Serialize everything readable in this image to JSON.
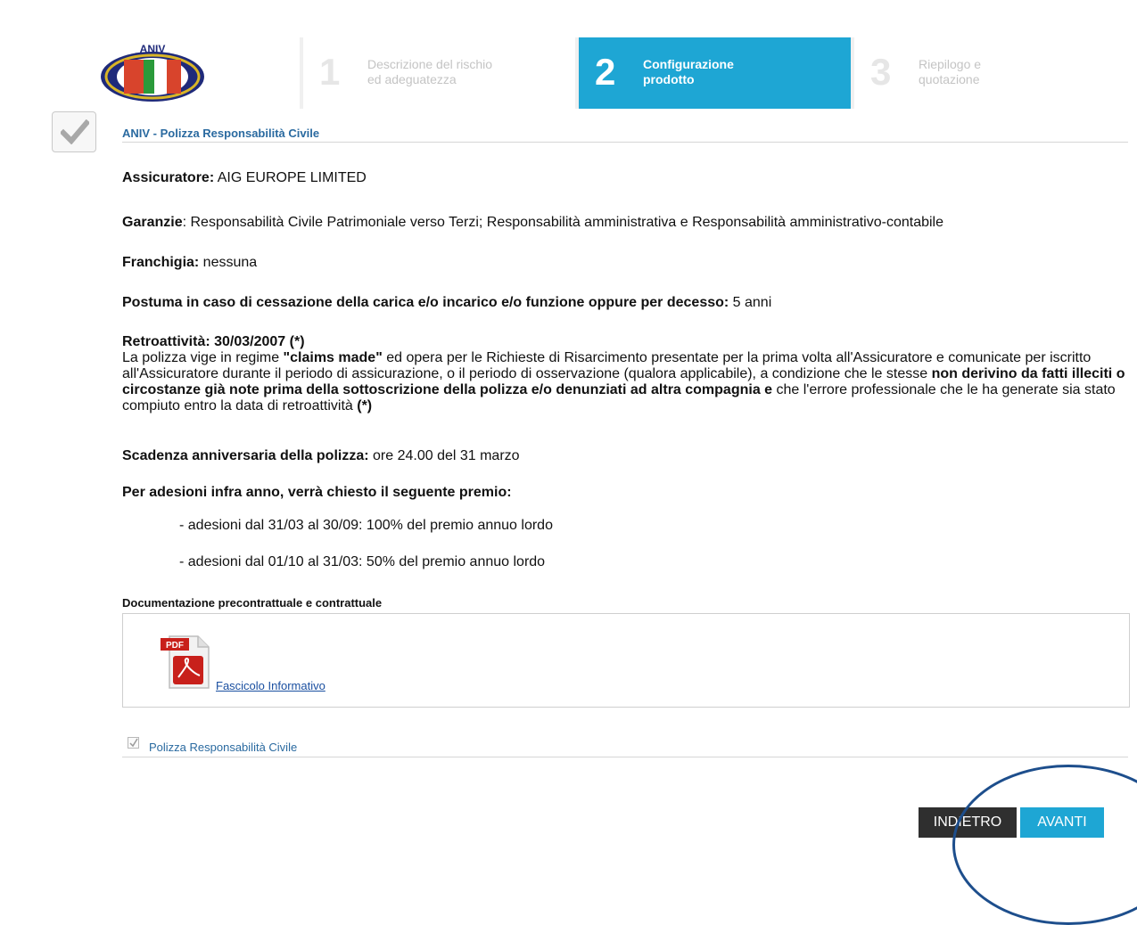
{
  "header": {
    "logo_text": "ANIV",
    "steps": [
      {
        "number": "1",
        "line1": "Descrizione del rischio",
        "line2": "ed adeguatezza",
        "active": false
      },
      {
        "number": "2",
        "line1": "Configurazione",
        "line2": "prodotto",
        "active": true
      },
      {
        "number": "3",
        "line1": "Riepilogo e",
        "line2": "quotazione",
        "active": false
      }
    ]
  },
  "product": {
    "title": "ANIV - Polizza Responsabilità Civile"
  },
  "details": {
    "insurer_label": "Assicuratore:",
    "insurer_value": " AIG EUROPE LIMITED",
    "guarantees_label": "Garanzie",
    "guarantees_value": ": Responsabilità Civile Patrimoniale verso Terzi; Responsabilità amministrativa e Responsabilità amministrativo-contabile",
    "deductible_label": "Franchigia:",
    "deductible_value": " nessuna",
    "posthumous_label": "Postuma in caso di cessazione della carica e/o incarico e/o funzione oppure per decesso:",
    "posthumous_value": " 5 anni",
    "retro_label": "Retroattività:  30/03/2007 (*)",
    "retro_t1": "La polizza vige in regime ",
    "retro_b1": "\"claims made\"",
    "retro_t2": " ed opera per le Richieste di Risarcimento presentate per la prima volta all'Assicuratore e comunicate per iscritto all'Assicuratore durante il periodo di assicurazione, o il periodo di osservazione (qualora applicabile), a condizione che le stesse ",
    "retro_b2": "non derivino da fatti illeciti o circostanze già note prima della sottoscrizione della polizza  e/o denunziati ad altra compagnia e",
    "retro_t3": "  che l'errore professionale che le ha generate sia stato compiuto entro la data di retroattività ",
    "retro_b3": "(*)",
    "expiry_label": "Scadenza anniversaria della polizza:",
    "expiry_value": "  ore 24.00 del 31 marzo",
    "midyear_heading": "Per adesioni infra anno, verrà chiesto il seguente premio:",
    "midyear_line1": "- adesioni dal 31/03 al 30/09:  100% del premio annuo lordo",
    "midyear_line2": "- adesioni dal 01/10 al 31/03:   50% del premio annuo lordo"
  },
  "documents": {
    "heading": "Documentazione precontrattuale e contrattuale",
    "pdf_badge": "PDF",
    "link_label": "Fascicolo Informativo"
  },
  "option": {
    "label": "Polizza Responsabilità Civile",
    "checked": true
  },
  "buttons": {
    "back": "INDIETRO",
    "next": "AVANTI"
  },
  "colors": {
    "accent": "#1ea6d4",
    "link": "#2a6aa0",
    "back_button": "#2f2f2f",
    "annotation": "#1d4e8c"
  }
}
